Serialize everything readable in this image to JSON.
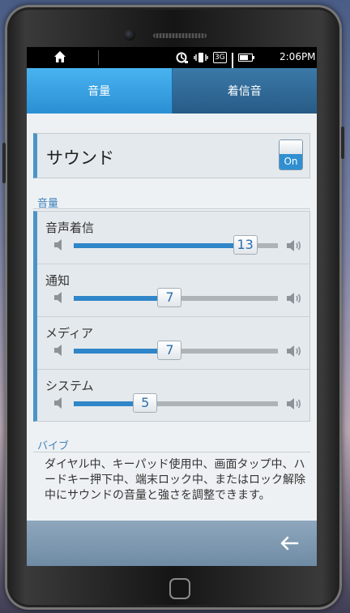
{
  "status_bar": {
    "time": "2:06PM",
    "network": "3G",
    "icons": [
      "home-icon",
      "sync-icon",
      "vibrate-icon",
      "3g-icon",
      "signal-icon",
      "battery-icon"
    ]
  },
  "tabs": [
    {
      "label": "音量",
      "active": true
    },
    {
      "label": "着信音",
      "active": false
    }
  ],
  "sound": {
    "label": "サウンド",
    "toggle_label": "On",
    "enabled": true
  },
  "volume_section": {
    "header": "音量",
    "items": [
      {
        "label": "音声着信",
        "value": "13",
        "level": 0.84
      },
      {
        "label": "通知",
        "value": "7",
        "level": 0.47
      },
      {
        "label": "メディア",
        "value": "7",
        "level": 0.47
      },
      {
        "label": "システム",
        "value": "5",
        "level": 0.35
      }
    ]
  },
  "vibe_section": {
    "header": "バイブ"
  },
  "description": "ダイヤル中、キーパッド使用中、画面タップ中、ハードキー押下中、端末ロック中、またはロック解除中にサウンドの音量と強さを調整できます。",
  "colors": {
    "accent": "#2f86c9",
    "tab_active": "#3aa3e4",
    "tab_inactive": "#2f6a97"
  }
}
